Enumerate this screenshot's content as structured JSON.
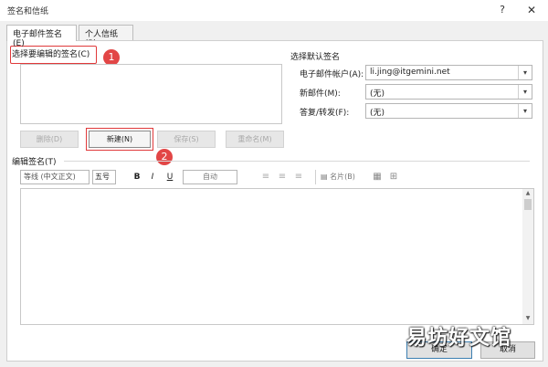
{
  "window": {
    "title": "签名和信纸",
    "help": "?",
    "close": "✕"
  },
  "tabs": [
    {
      "label": "电子邮件签名(E)"
    },
    {
      "label": "个人信纸(P)"
    }
  ],
  "left": {
    "select_label": "选择要编辑的签名(C)",
    "buttons": {
      "delete": "删除(D)",
      "new": "新建(N)",
      "save": "保存(S)",
      "rename": "重命名(M)"
    }
  },
  "annotations": {
    "badge1": "1",
    "badge2": "2"
  },
  "right": {
    "heading": "选择默认签名",
    "account_label": "电子邮件帐户(A):",
    "account_value": "li.jing@itgemini.net",
    "newmsg_label": "新邮件(M):",
    "newmsg_value": "(无)",
    "reply_label": "答复/转发(F):",
    "reply_value": "(无)"
  },
  "editor": {
    "label": "编辑签名(T)",
    "font": "等线 (中文正文)",
    "size": "五号",
    "bold": "B",
    "italic": "I",
    "underline": "U",
    "color": "自动",
    "bizcard": "名片(B)"
  },
  "footer": {
    "ok": "确定",
    "cancel": "取消"
  },
  "watermark": "易坊好文馆",
  "icons": {
    "help": "help-icon",
    "close": "close-icon",
    "dropdown": "chevron-down-icon",
    "align_left": "align-left-icon",
    "align_center": "align-center-icon",
    "align_right": "align-right-icon",
    "bizcard": "business-card-icon",
    "picture": "insert-picture-icon",
    "link": "hyperlink-icon"
  },
  "colors": {
    "highlight": "#e0393a",
    "badge": "#e24646"
  }
}
